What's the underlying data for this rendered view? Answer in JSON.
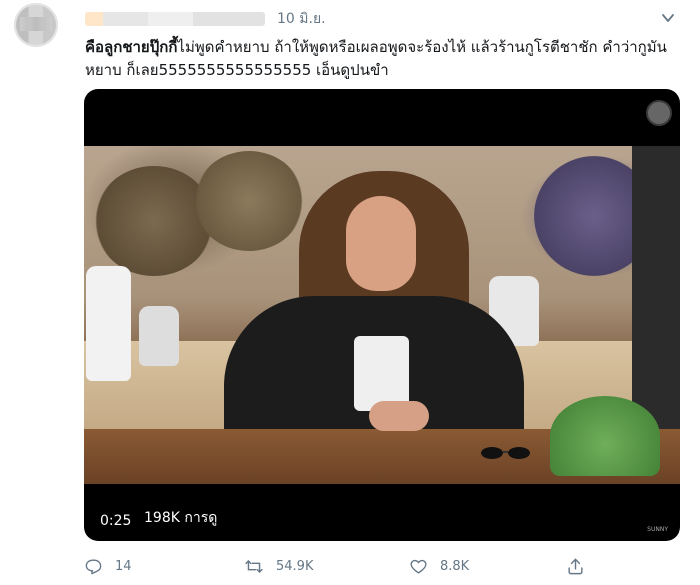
{
  "tweet": {
    "time": "10 มิ.ย.",
    "text_bold": "คือลูกชายปุ๊กกี้",
    "text_rest": "ไม่พูดคำหยาบ ถ้าให้พูดหรือเผลอพูดจะร้องไห้ แล้วร้านกูโรตีชาชัก คำว่ากูมันหยาบ ก็เลย5555555555555555 เอ็นดูปนขำ"
  },
  "video": {
    "duration": "0:25",
    "views": "198K การดู",
    "watermark": "SUNNY"
  },
  "actions": {
    "reply_count": "14",
    "retweet_count": "54.9K",
    "like_count": "8.8K"
  },
  "colors": {
    "text": "#14171a",
    "muted": "#657786",
    "media_bg": "#000000"
  },
  "icons": [
    "reply-icon",
    "retweet-icon",
    "like-icon",
    "share-icon",
    "caret-down-icon",
    "mute-icon"
  ]
}
